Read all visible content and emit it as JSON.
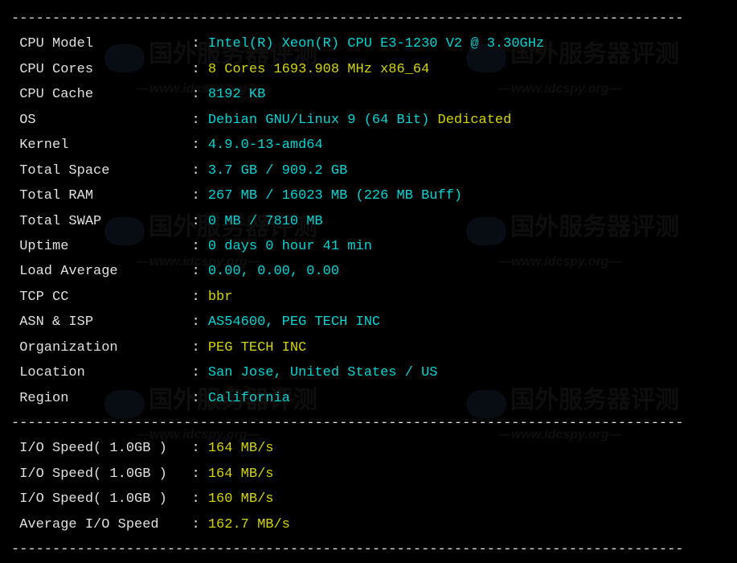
{
  "divider": "----------------------------------------------------------------------------------",
  "labels": {
    "cpu_model": "CPU Model",
    "cpu_cores": "CPU Cores",
    "cpu_cache": "CPU Cache",
    "os": "OS",
    "kernel": "Kernel",
    "total_space": "Total Space",
    "total_ram": "Total RAM",
    "total_swap": "Total SWAP",
    "uptime": "Uptime",
    "load_average": "Load Average",
    "tcp_cc": "TCP CC",
    "asn_isp": "ASN & ISP",
    "organization": "Organization",
    "location": "Location",
    "region": "Region",
    "io_speed": "I/O Speed( 1.0GB )",
    "avg_io": "Average I/O Speed"
  },
  "values": {
    "cpu_model": "Intel(R) Xeon(R) CPU E3-1230 V2 @ 3.30GHz",
    "cpu_cores": "8 Cores 1693.908 MHz x86_64",
    "cpu_cache": "8192 KB",
    "os_main": "Debian GNU/Linux 9 (64 Bit)",
    "os_type": "Dedicated",
    "kernel": "4.9.0-13-amd64",
    "total_space": "3.7 GB / 909.2 GB",
    "total_ram": "267 MB / 16023 MB (226 MB Buff)",
    "total_swap": "0 MB / 7810 MB",
    "uptime": "0 days 0 hour 41 min",
    "load_average": "0.00, 0.00, 0.00",
    "tcp_cc": "bbr",
    "asn_isp": "AS54600, PEG TECH INC",
    "organization": "PEG TECH INC",
    "location": "San Jose, United States / US",
    "region": "California",
    "io1": "164 MB/s",
    "io2": "164 MB/s",
    "io3": "160 MB/s",
    "avg_io": "162.7 MB/s"
  },
  "watermark": {
    "text_cn": "国外服务器评测",
    "text_url": "—www.idcspy.org—"
  }
}
